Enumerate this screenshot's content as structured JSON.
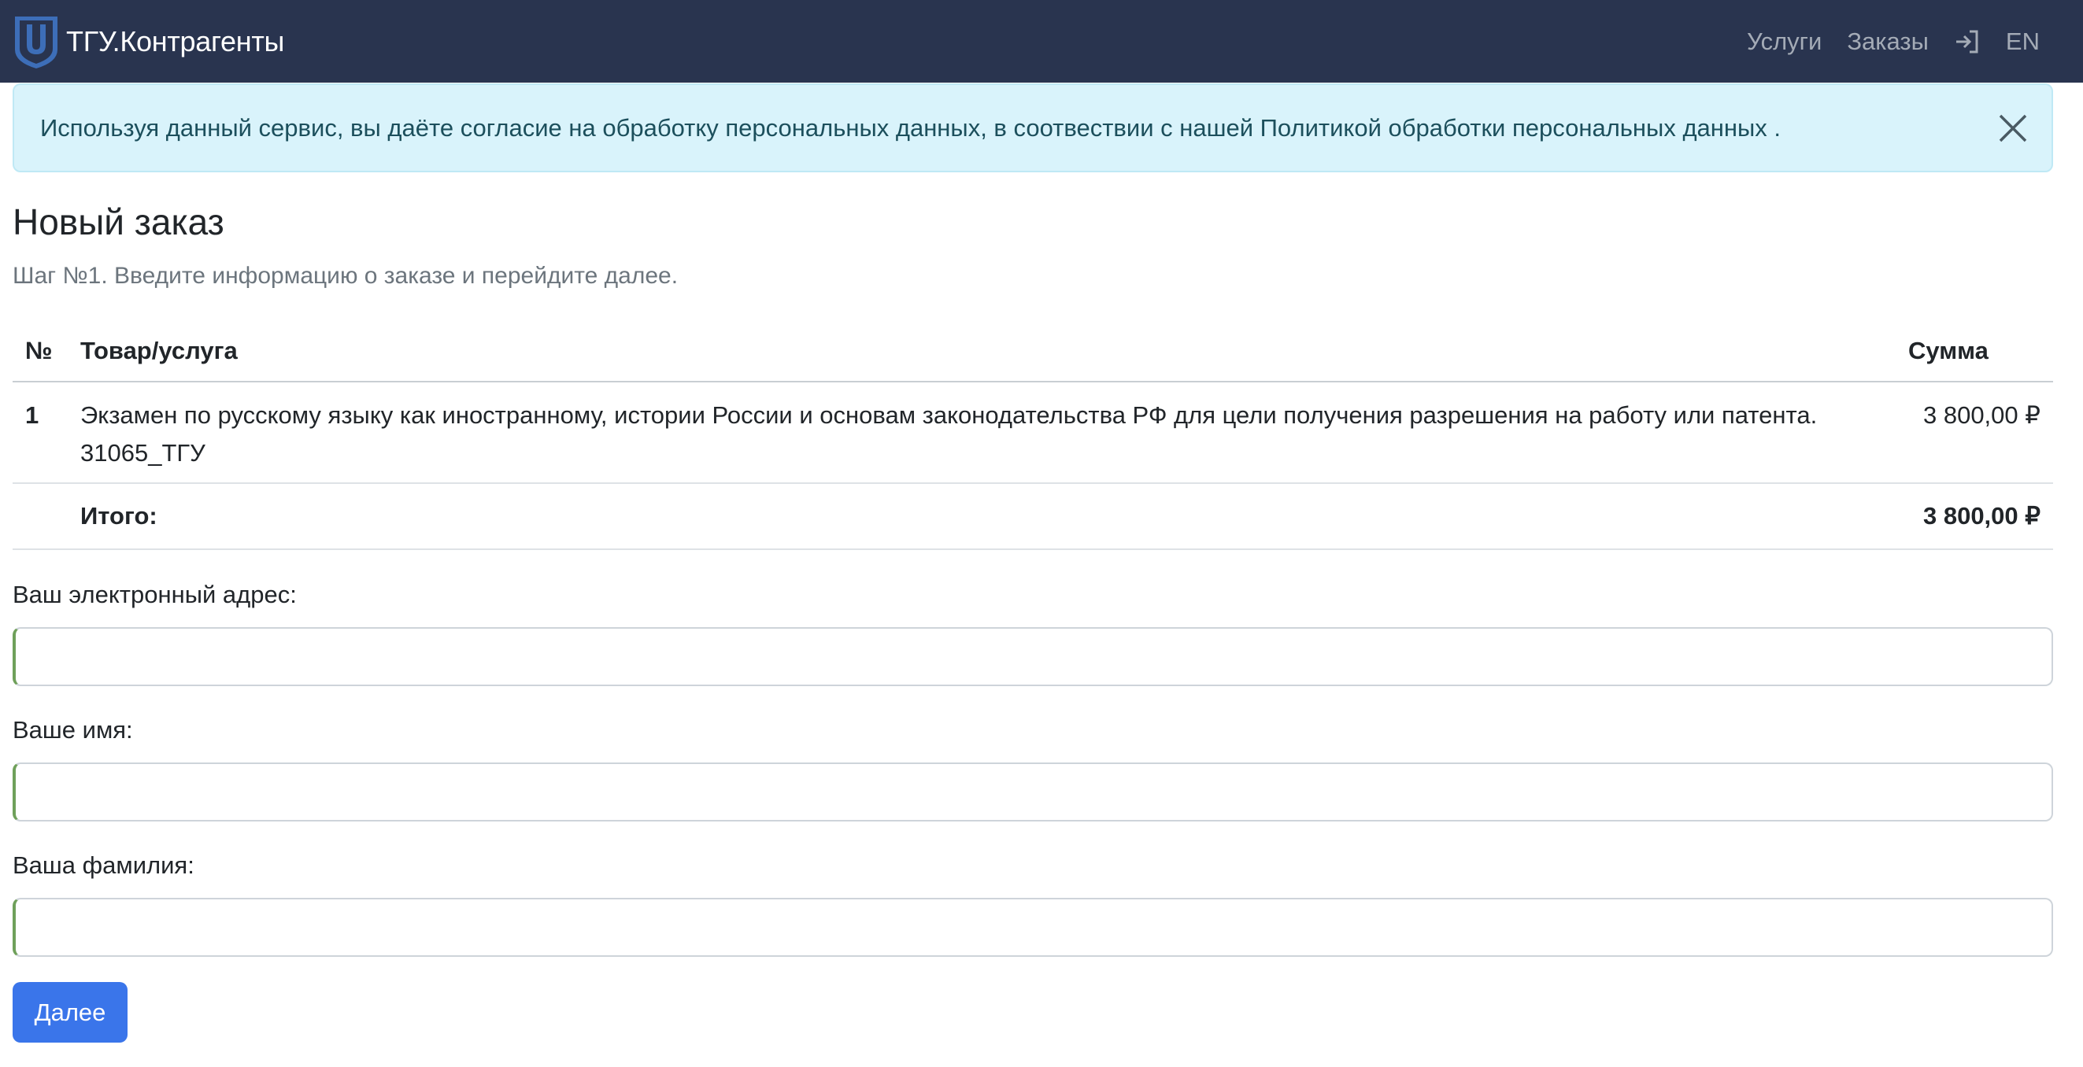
{
  "navbar": {
    "brand": "ТГУ.Контрагенты",
    "links": [
      "Услуги",
      "Заказы"
    ],
    "login_icon": "login-icon",
    "language": "EN"
  },
  "alert": {
    "text": "Используя данный сервис, вы даёте согласие на обработку персональных данных, в соотвествии с нашей Политикой обработки персональных данных .",
    "close_icon": "close-icon"
  },
  "page": {
    "title": "Новый заказ",
    "step": "Шаг №1. Введите информацию о заказе и перейдите далее."
  },
  "table": {
    "headers": [
      "№",
      "Товар/услуга",
      "Сумма"
    ],
    "rows": [
      {
        "num": "1",
        "item": "Экзамен по русскому языку как иностранному, истории России и основам законодательства РФ для цели получения разрешения на работу или патента. 31065_ТГУ",
        "sum": "3 800,00 ₽"
      }
    ],
    "total_label": "Итого:",
    "total_value": "3 800,00 ₽"
  },
  "form": {
    "email_label": "Ваш электронный адрес:",
    "email_value": "",
    "name_label": "Ваше имя:",
    "name_value": "",
    "surname_label": "Ваша фамилия:",
    "surname_value": "",
    "submit_label": "Далее"
  },
  "colors": {
    "navbar": "#29344f",
    "alert_bg": "#d9f3fb",
    "primary": "#3a75ea",
    "input_valid_accent": "#6fa05a"
  }
}
